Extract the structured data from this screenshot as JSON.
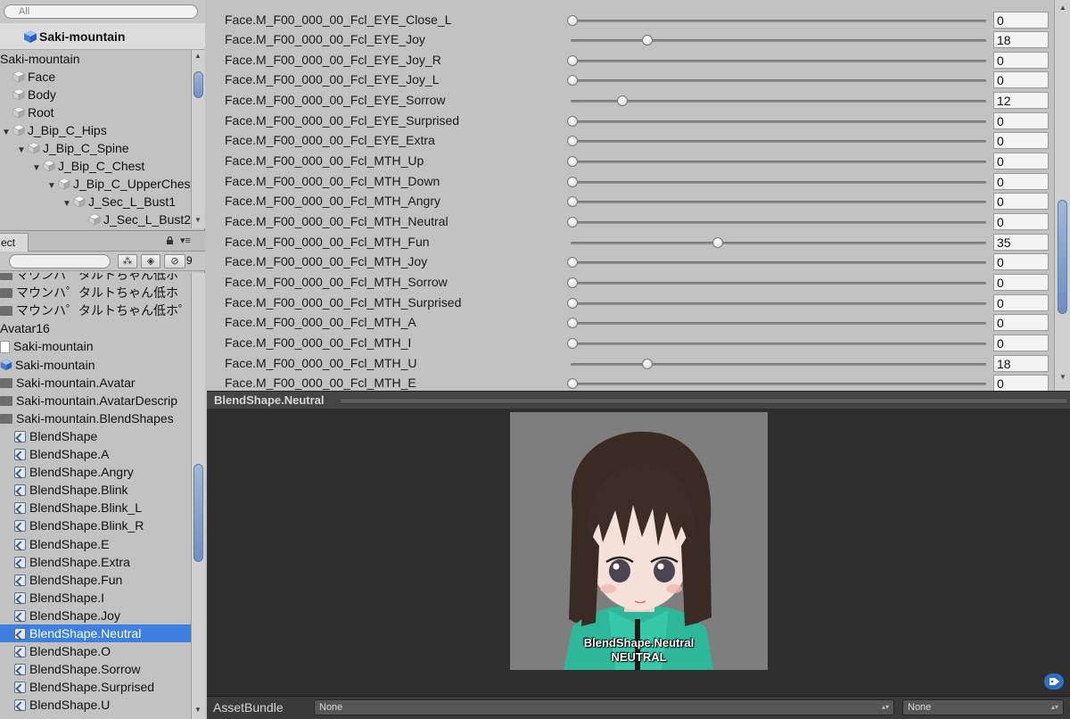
{
  "hierarchy": {
    "search_placeholder": "All",
    "scene_title": "Saki-mountain",
    "items": [
      {
        "label": "Saki-mountain",
        "depth": 0,
        "arrow": "",
        "icon": "none"
      },
      {
        "label": "Face",
        "depth": 0,
        "arrow": "",
        "icon": "cube-grey"
      },
      {
        "label": "Body",
        "depth": 0,
        "arrow": "",
        "icon": "cube-grey"
      },
      {
        "label": "Root",
        "depth": 0,
        "arrow": "",
        "icon": "cube-grey"
      },
      {
        "label": "J_Bip_C_Hips",
        "depth": 0,
        "arrow": "▼",
        "icon": "cube-grey"
      },
      {
        "label": "J_Bip_C_Spine",
        "depth": 1,
        "arrow": "▼",
        "icon": "cube-grey"
      },
      {
        "label": "J_Bip_C_Chest",
        "depth": 2,
        "arrow": "▼",
        "icon": "cube-grey"
      },
      {
        "label": "J_Bip_C_UpperChest",
        "depth": 3,
        "arrow": "▼",
        "icon": "cube-grey"
      },
      {
        "label": "J_Sec_L_Bust1",
        "depth": 4,
        "arrow": "▼",
        "icon": "cube-grey"
      },
      {
        "label": "J_Sec_L_Bust2",
        "depth": 5,
        "arrow": "",
        "icon": "cube-grey"
      }
    ]
  },
  "project": {
    "tab_label": "ect",
    "hidden_count": "9",
    "items": [
      {
        "label": "マウンハ゜タルトちゃん低ホ",
        "icon": "folder",
        "selected": false
      },
      {
        "label": "マウンハ゜タルトちゃん低ホ",
        "icon": "folder",
        "selected": false
      },
      {
        "label": "マウンハ゜タルトちゃん低ホ゜",
        "icon": "folder",
        "selected": false
      },
      {
        "label": "Avatar16",
        "icon": "none",
        "selected": false
      },
      {
        "label": "Saki-mountain",
        "icon": "doc",
        "selected": false
      },
      {
        "label": "Saki-mountain",
        "icon": "prefab",
        "selected": false
      },
      {
        "label": "Saki-mountain.Avatar",
        "icon": "folder",
        "selected": false
      },
      {
        "label": "Saki-mountain.AvatarDescrip",
        "icon": "folder",
        "selected": false
      },
      {
        "label": "Saki-mountain.BlendShapes",
        "icon": "folder",
        "selected": false
      },
      {
        "label": "BlendShape",
        "icon": "asset",
        "selected": false
      },
      {
        "label": "BlendShape.A",
        "icon": "asset",
        "selected": false
      },
      {
        "label": "BlendShape.Angry",
        "icon": "asset",
        "selected": false
      },
      {
        "label": "BlendShape.Blink",
        "icon": "asset",
        "selected": false
      },
      {
        "label": "BlendShape.Blink_L",
        "icon": "asset",
        "selected": false
      },
      {
        "label": "BlendShape.Blink_R",
        "icon": "asset",
        "selected": false
      },
      {
        "label": "BlendShape.E",
        "icon": "asset",
        "selected": false
      },
      {
        "label": "BlendShape.Extra",
        "icon": "asset",
        "selected": false
      },
      {
        "label": "BlendShape.Fun",
        "icon": "asset",
        "selected": false
      },
      {
        "label": "BlendShape.I",
        "icon": "asset",
        "selected": false
      },
      {
        "label": "BlendShape.Joy",
        "icon": "asset",
        "selected": false
      },
      {
        "label": "BlendShape.Neutral",
        "icon": "asset",
        "selected": true
      },
      {
        "label": "BlendShape.O",
        "icon": "asset",
        "selected": false
      },
      {
        "label": "BlendShape.Sorrow",
        "icon": "asset",
        "selected": false
      },
      {
        "label": "BlendShape.Surprised",
        "icon": "asset",
        "selected": false
      },
      {
        "label": "BlendShape.U",
        "icon": "asset",
        "selected": false
      }
    ]
  },
  "sliders": [
    {
      "label": "Face.M_F00_000_00_Fcl_EYE_Close_L",
      "value": 0
    },
    {
      "label": "Face.M_F00_000_00_Fcl_EYE_Joy",
      "value": 18
    },
    {
      "label": "Face.M_F00_000_00_Fcl_EYE_Joy_R",
      "value": 0
    },
    {
      "label": "Face.M_F00_000_00_Fcl_EYE_Joy_L",
      "value": 0
    },
    {
      "label": "Face.M_F00_000_00_Fcl_EYE_Sorrow",
      "value": 12
    },
    {
      "label": "Face.M_F00_000_00_Fcl_EYE_Surprised",
      "value": 0
    },
    {
      "label": "Face.M_F00_000_00_Fcl_EYE_Extra",
      "value": 0
    },
    {
      "label": "Face.M_F00_000_00_Fcl_MTH_Up",
      "value": 0
    },
    {
      "label": "Face.M_F00_000_00_Fcl_MTH_Down",
      "value": 0
    },
    {
      "label": "Face.M_F00_000_00_Fcl_MTH_Angry",
      "value": 0
    },
    {
      "label": "Face.M_F00_000_00_Fcl_MTH_Neutral",
      "value": 0
    },
    {
      "label": "Face.M_F00_000_00_Fcl_MTH_Fun",
      "value": 35
    },
    {
      "label": "Face.M_F00_000_00_Fcl_MTH_Joy",
      "value": 0
    },
    {
      "label": "Face.M_F00_000_00_Fcl_MTH_Sorrow",
      "value": 0
    },
    {
      "label": "Face.M_F00_000_00_Fcl_MTH_Surprised",
      "value": 0
    },
    {
      "label": "Face.M_F00_000_00_Fcl_MTH_A",
      "value": 0
    },
    {
      "label": "Face.M_F00_000_00_Fcl_MTH_I",
      "value": 0
    },
    {
      "label": "Face.M_F00_000_00_Fcl_MTH_U",
      "value": 18
    },
    {
      "label": "Face.M_F00_000_00_Fcl_MTH_E",
      "value": 0
    }
  ],
  "preview": {
    "title": "BlendShape.Neutral",
    "caption_name": "BlendShape.Neutral",
    "caption_preset": "NEUTRAL"
  },
  "asset_bundle": {
    "label": "AssetBundle",
    "name_value": "None",
    "variant_value": "None"
  },
  "colors": {
    "selection": "#3d80df",
    "panel": "#c2c2c2",
    "preview_bg": "#2e2e2e"
  }
}
